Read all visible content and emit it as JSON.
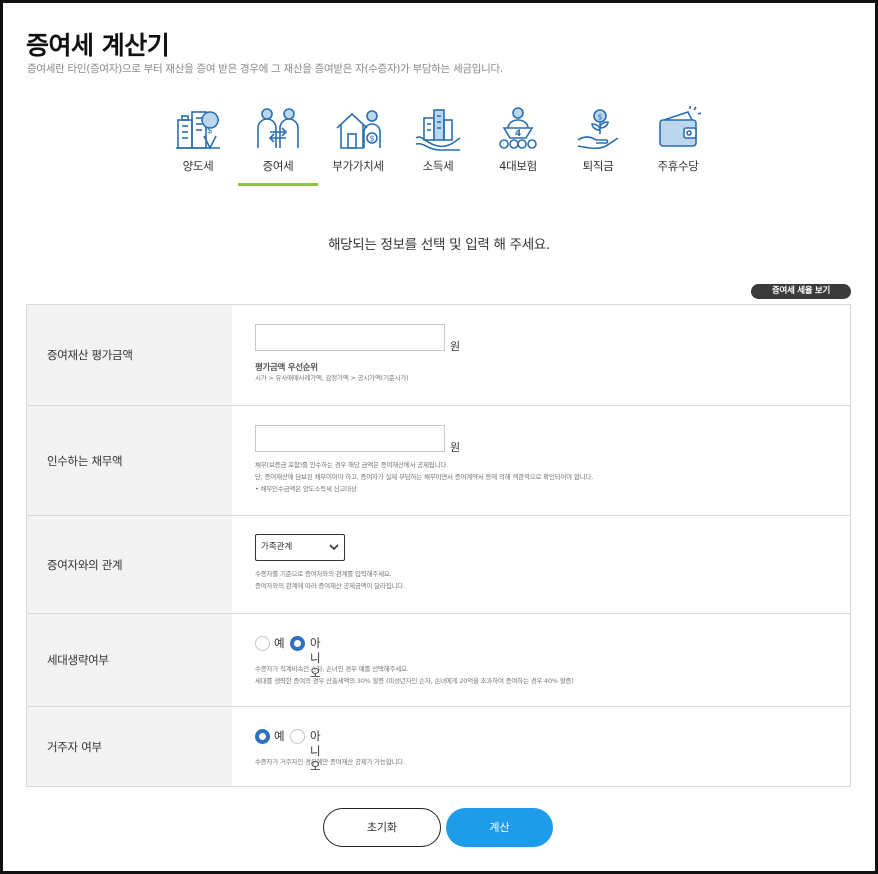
{
  "page": {
    "title": "증여세 계산기",
    "description": "증여세란 타인(증여자)으로 부터 재산을 증여 받은 경우에 그 재산을 증여받은 자(수증자)가 부담하는 세금입니다."
  },
  "tabs": [
    {
      "label": "양도세",
      "icon": "building-location-icon",
      "active": false
    },
    {
      "label": "증여세",
      "icon": "people-exchange-icon",
      "active": true
    },
    {
      "label": "부가가치세",
      "icon": "house-person-icon",
      "active": false
    },
    {
      "label": "소득세",
      "icon": "city-hand-icon",
      "active": false
    },
    {
      "label": "4대보험",
      "icon": "person-shield-icon",
      "active": false
    },
    {
      "label": "퇴직금",
      "icon": "money-plant-hand-icon",
      "active": false
    },
    {
      "label": "주휴수당",
      "icon": "wallet-icon",
      "active": false
    }
  ],
  "instruction": "해당되는 정보를 선택 및 입력 해 주세요.",
  "tax_rate_button": "증여세 세율 보기",
  "form": {
    "gift_value": {
      "label": "증여재산 평가금액",
      "value": "",
      "unit": "원",
      "note_title": "평가금액 우선순위",
      "note": "시가 > 유사매매사례가액, 감정가액 > 공시가액(기준시가)"
    },
    "debt": {
      "label": "인수하는 채무액",
      "value": "",
      "unit": "원",
      "notes": [
        "채무(보증금 포함)를 인수하는 경우 해당 금액은 증여재산에서 공제됩니다.",
        "단, 증여재산에 담보된 채무이어야 하고, 증여자가 실제 부담하는 채무이면서 증여계약서 등에 의해 객관적으로 확인되어야 합니다.",
        "• 채무인수금액은 양도소득세 신고대상"
      ]
    },
    "relation": {
      "label": "증여자와의 관계",
      "selected": "가족관계",
      "notes": [
        "수증자를 기준으로 증여자와의 관계를 입력해주세요.",
        "증여자와의 관계에 따라 증여재산 공제금액이 달라집니다."
      ]
    },
    "generation_skip": {
      "label": "세대생략여부",
      "options": [
        "예",
        "아니오"
      ],
      "selected": "아니오",
      "notes": [
        "수증자가 직계비속인 손자, 손녀인 경우 예를 선택해주세요.",
        "세대를 생략한 증여의 경우 산출세액의 30% 할증 (미성년자인 손자, 손녀에게 20억을 초과하여 증여하는 경우 40% 할증)"
      ]
    },
    "resident": {
      "label": "거주자 여부",
      "options": [
        "예",
        "아니오"
      ],
      "selected": "예",
      "note": "수증자가 거주자인 경우에만 증여재산 공제가 가능합니다."
    }
  },
  "buttons": {
    "reset": "초기화",
    "calculate": "계산"
  },
  "colors": {
    "active_tab": "#8cc63f",
    "calculate_button": "#1e9be9",
    "radio_checked": "#2f6fc2",
    "icon_blue": "#2a6fb0"
  }
}
